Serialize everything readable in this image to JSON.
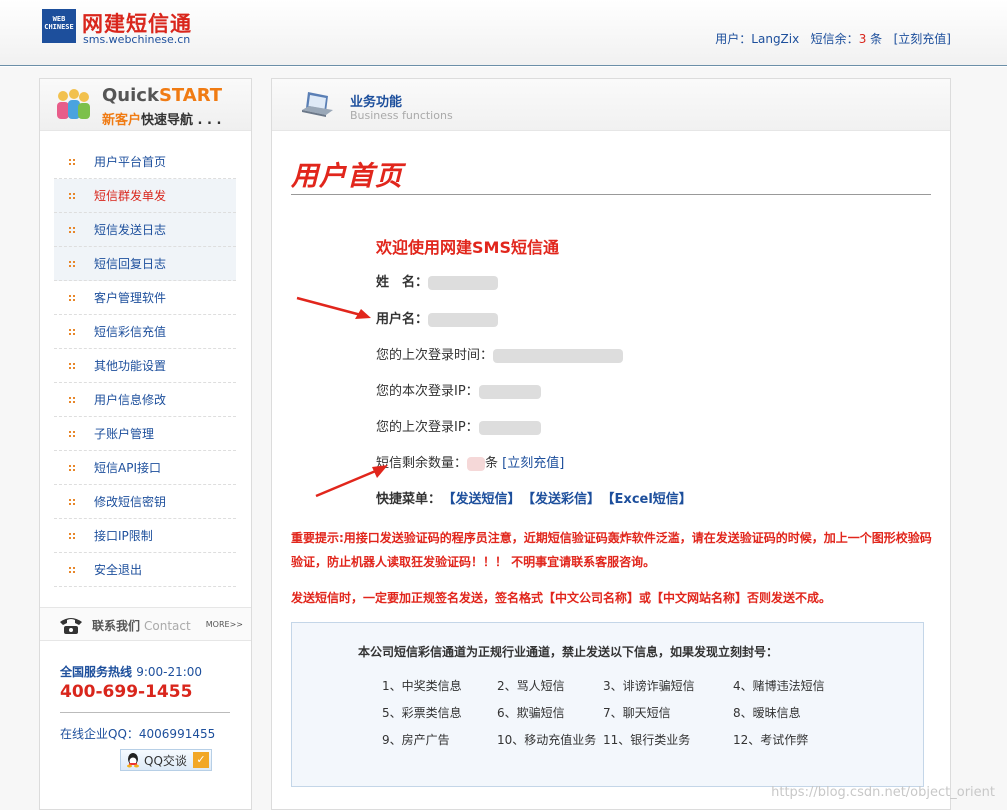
{
  "header": {
    "logo_text_top": "WEB",
    "logo_text_bottom": "CHINESE",
    "brand_title": "网建短信通",
    "brand_url": "sms.webchinese.cn",
    "user_label": "用户：",
    "username": "LangZix",
    "balance_label": "短信余：",
    "balance_value": "3",
    "balance_unit": "条",
    "recharge_link": "[立刻充值]"
  },
  "sidebar": {
    "quickstart_title_a": "Quick",
    "quickstart_title_b": "START",
    "quickstart_sub_a": "新客户",
    "quickstart_sub_b": "快速导航 . . .",
    "items": [
      {
        "label": "用户平台首页"
      },
      {
        "label": "短信群发单发"
      },
      {
        "label": "短信发送日志"
      },
      {
        "label": "短信回复日志"
      },
      {
        "label": "客户管理软件"
      },
      {
        "label": "短信彩信充值"
      },
      {
        "label": "其他功能设置"
      },
      {
        "label": "用户信息修改"
      },
      {
        "label": "子账户管理"
      },
      {
        "label": "短信API接口"
      },
      {
        "label": "修改短信密钥"
      },
      {
        "label": "接口IP限制"
      },
      {
        "label": "安全退出"
      }
    ],
    "contact_title": "联系我们",
    "contact_title_en": "Contact",
    "contact_more": "MORE>>",
    "hotline_label": "全国服务热线",
    "hotline_hours": "9:00-21:00",
    "hotline_number": "400-699-1455",
    "qq_label": "在线企业QQ：4006991455",
    "qq_button": "QQ交谈"
  },
  "main": {
    "section_title": "业务功能",
    "section_sub": "Business functions",
    "page_title": "用户首页",
    "welcome": "欢迎使用网建SMS短信通",
    "name_label": "姓　名：",
    "username_label": "用户名：",
    "last_login_time_label": "您的上次登录时间：",
    "current_ip_label": "您的本次登录IP：",
    "last_ip_label": "您的上次登录IP：",
    "remaining_label": "短信剩余数量：",
    "remaining_unit": "条",
    "remaining_link": "[立刻充值]",
    "quick_menu_label": "快捷菜单：",
    "quick_menu_items": [
      "【发送短信】",
      "【发送彩信】",
      "【Excel短信】"
    ],
    "notice_1": "重要提示:用接口发送验证码的程序员注意，近期短信验证码轰炸软件泛滥，请在发送验证码的时候，加上一个图形校验码验证，防止机器人读取狂发验证码！！！ 不明事宜请联系客服咨询。",
    "notice_2": "发送短信时，一定要加正规签名发送，签名格式【中文公司名称】或【中文网站名称】否则发送不成。",
    "rules_title": "本公司短信彩信通道为正规行业通道，禁止发送以下信息，如果发现立刻封号：",
    "rules": [
      "1、中奖类信息",
      "2、骂人短信",
      "3、诽谤诈骗短信",
      "4、赌博违法短信",
      "5、彩票类信息",
      "6、欺骗短信",
      "7、聊天短信",
      "8、暧昧信息",
      "9、房产广告",
      "10、移动充值业务",
      "11、银行类业务",
      "12、考试作弊"
    ]
  },
  "watermark": "https://blog.csdn.net/object_orient",
  "colors": {
    "brand_red": "#e1261c",
    "link_blue": "#1d4f9c",
    "accent_orange": "#f07b13"
  }
}
